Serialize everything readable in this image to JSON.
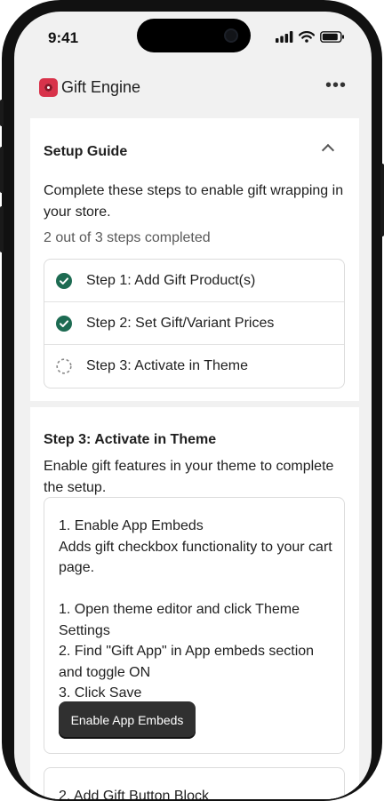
{
  "status_bar": {
    "time": "9:41",
    "icons": [
      "signal-icon",
      "wifi-icon",
      "battery-icon"
    ]
  },
  "app": {
    "title": "Gift Engine",
    "logo_icon": "gift-engine-logo",
    "more_label": "•••"
  },
  "setup_guide": {
    "title": "Setup Guide",
    "description": "Complete these steps to enable gift wrapping in your store.",
    "progress_text": "2 out of 3 steps completed",
    "completed_count": 2,
    "total_count": 3,
    "steps": [
      {
        "label": "Step 1: Add Gift Product(s)",
        "status": "completed"
      },
      {
        "label": "Step 2: Set Gift/Variant Prices",
        "status": "completed"
      },
      {
        "label": "Step 3: Activate in Theme",
        "status": "pending"
      }
    ]
  },
  "step3": {
    "title": "Step 3: Activate in Theme",
    "description": "Enable gift features in your theme to complete the setup.",
    "tasks": [
      {
        "heading": "1. Enable App Embeds",
        "summary": "Adds gift checkbox functionality to your cart page.",
        "instructions": [
          "1. Open theme editor and click Theme Settings",
          "2. Find \"Gift App\" in App embeds section and toggle ON",
          "3. Click Save"
        ],
        "button_label": "Enable App Embeds"
      },
      {
        "heading": "2. Add Gift Button Block"
      }
    ]
  },
  "colors": {
    "completed": "#1d6b52",
    "pending": "#8a8a8a",
    "primary_button": "#303030",
    "logo": "#d8324a"
  }
}
